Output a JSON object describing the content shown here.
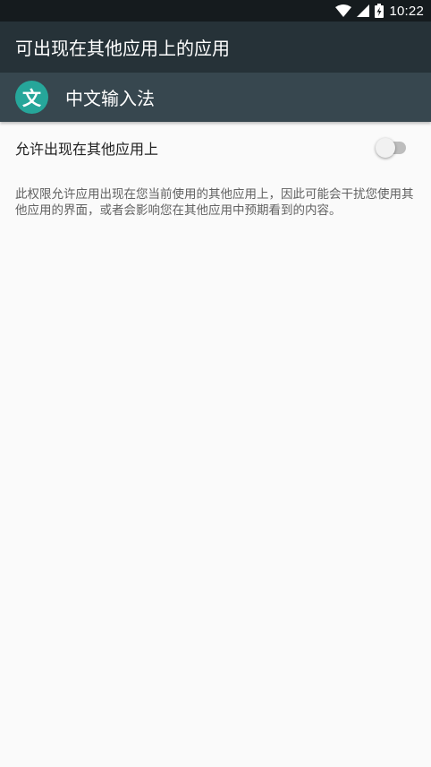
{
  "status_bar": {
    "time": "10:22",
    "icons": [
      "wifi-icon",
      "cellular-signal-icon",
      "battery-charging-icon"
    ]
  },
  "toolbar": {
    "title": "可出现在其他应用上的应用"
  },
  "app_header": {
    "icon_glyph": "文",
    "icon_color": "#26a69a",
    "app_name": "中文输入法"
  },
  "setting": {
    "label": "允许出现在其他应用上",
    "enabled": false
  },
  "description": {
    "text": "此权限允许应用出现在您当前使用的其他应用上，因此可能会干扰您使用其他应用的界面，或者会影响您在其他应用中预期看到的内容。"
  },
  "colors": {
    "status_bar": "#151b1e",
    "toolbar": "#263238",
    "app_header": "#37474f",
    "background": "#fafafa"
  }
}
